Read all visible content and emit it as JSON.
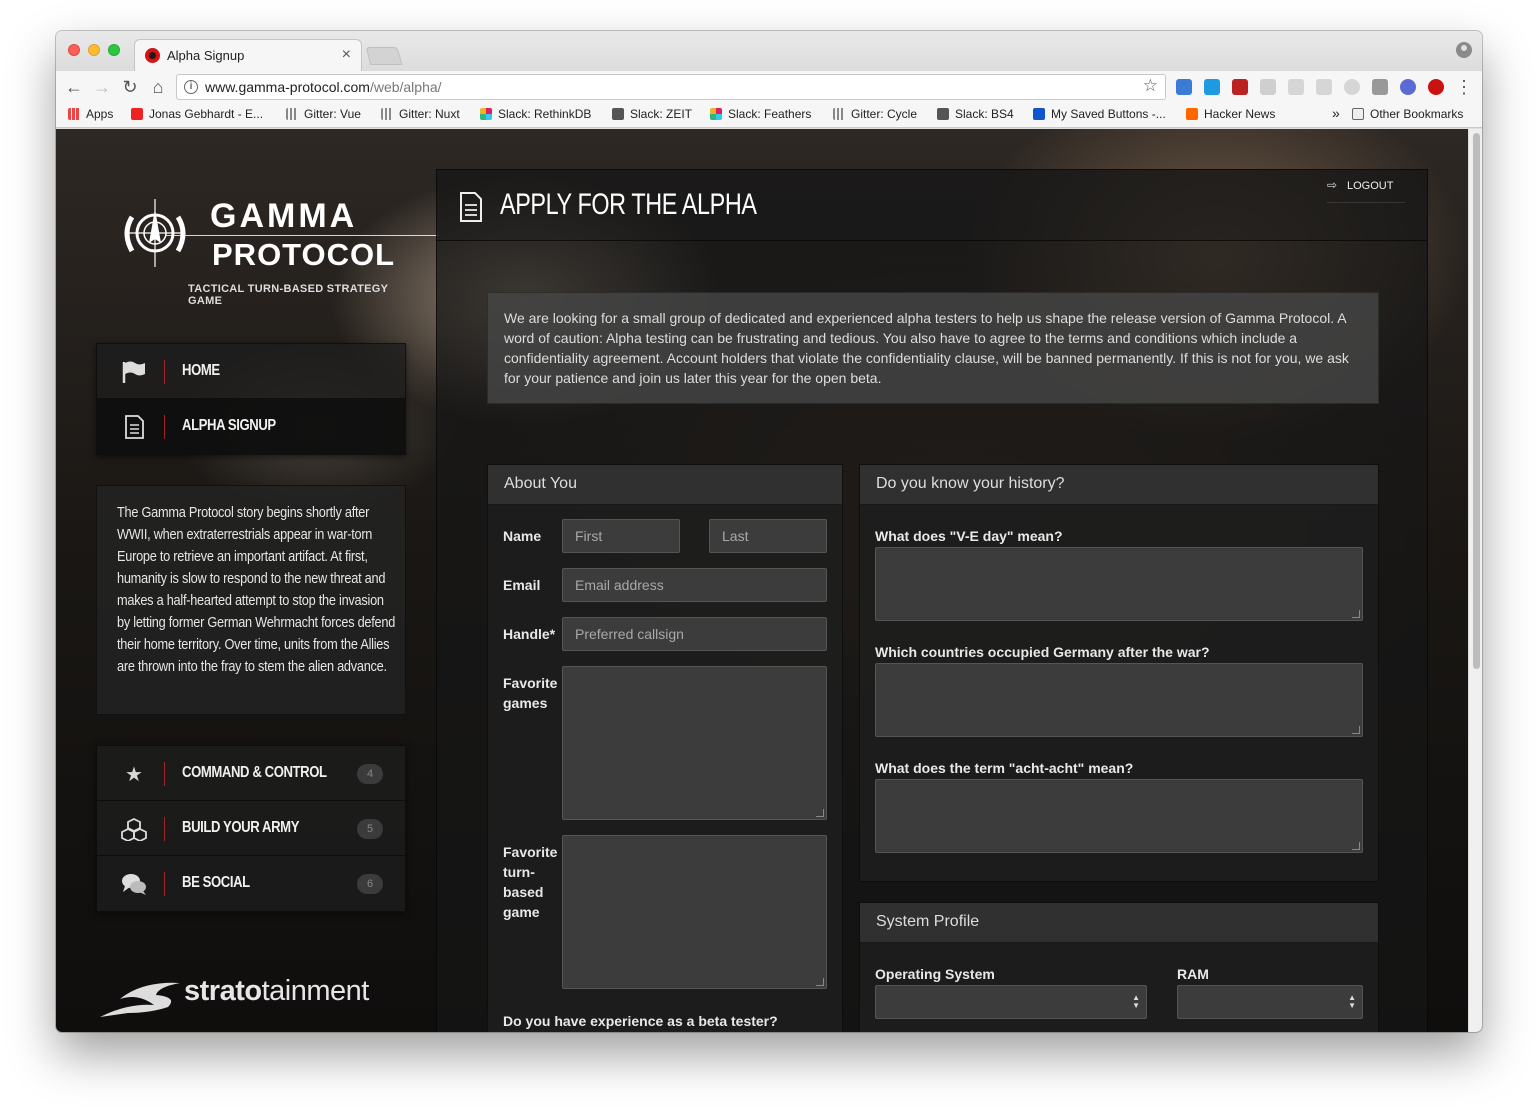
{
  "browser": {
    "tab_title": "Alpha Signup",
    "tab_close": "×",
    "url_host": "www.gamma-protocol.com",
    "url_path": "/web/alpha/",
    "bookmarks": [
      {
        "label": "Apps",
        "color": "#e44"
      },
      {
        "label": "Jonas Gebhardt - E...",
        "color": "#e22"
      },
      {
        "label": "Gitter: Vue",
        "color": "#888"
      },
      {
        "label": "Gitter: Nuxt",
        "color": "#888"
      },
      {
        "label": "Slack: RethinkDB",
        "color": "#3a8"
      },
      {
        "label": "Slack: ZEIT",
        "color": "#555"
      },
      {
        "label": "Slack: Feathers",
        "color": "#3a8"
      },
      {
        "label": "Gitter: Cycle",
        "color": "#888"
      },
      {
        "label": "Slack: BS4",
        "color": "#555"
      },
      {
        "label": "My Saved Buttons -...",
        "color": "#15c"
      },
      {
        "label": "Hacker News",
        "color": "#f60"
      }
    ],
    "overflow": "»",
    "other_bookmarks": "Other Bookmarks"
  },
  "logo": {
    "line1": "GAMMA",
    "line2": "PROTOCOL",
    "tagline": "TACTICAL TURN-BASED STRATEGY GAME"
  },
  "nav": {
    "home": "HOME",
    "alpha_signup": "ALPHA SIGNUP"
  },
  "story": "The Gamma Protocol story begins shortly after WWII, when extraterrestrials appear in war-torn Europe to retrieve an important artifact. At first, humanity is slow to respond to the new threat and makes a half-hearted attempt to stop the invasion by letting former German Wehrmacht forces defend their home territory. Over time, units from the Allies are thrown into the fray to stem the alien advance.",
  "sections": [
    {
      "label": "COMMAND & CONTROL",
      "badge": "4",
      "icon": "star-icon"
    },
    {
      "label": "BUILD YOUR ARMY",
      "badge": "5",
      "icon": "cubes-icon"
    },
    {
      "label": "BE SOCIAL",
      "badge": "6",
      "icon": "chat-icon"
    }
  ],
  "company": {
    "bold": "strato",
    "rest": "tainment"
  },
  "main": {
    "title": "APPLY FOR THE ALPHA",
    "logout": "LOGOUT",
    "intro": "We are looking for a small group of dedicated and experienced alpha testers to help us shape the release version of Gamma Protocol. A word of caution: Alpha testing can be frustrating and tedious. You also have to agree to the terms and conditions which include a confidentiality agreement. Account holders that violate the confidentiality clause, will be banned permanently. If this is not for you, we ask for your patience and join us later this year for the open beta."
  },
  "about": {
    "heading": "About You",
    "name_label": "Name",
    "first_placeholder": "First",
    "last_placeholder": "Last",
    "email_label": "Email",
    "email_placeholder": "Email address",
    "handle_label": "Handle*",
    "handle_placeholder": "Preferred callsign",
    "games_label": "Favorite games",
    "turn_label": "Favorite turn-based game",
    "beta_label": "Do you have experience as a beta tester?"
  },
  "history": {
    "heading": "Do you know your history?",
    "q1": "What does \"V-E day\" mean?",
    "q2": "Which countries occupied Germany after the war?",
    "q3": "What does the term \"acht-acht\" mean?"
  },
  "system": {
    "heading": "System Profile",
    "os_label": "Operating System",
    "ram_label": "RAM"
  }
}
